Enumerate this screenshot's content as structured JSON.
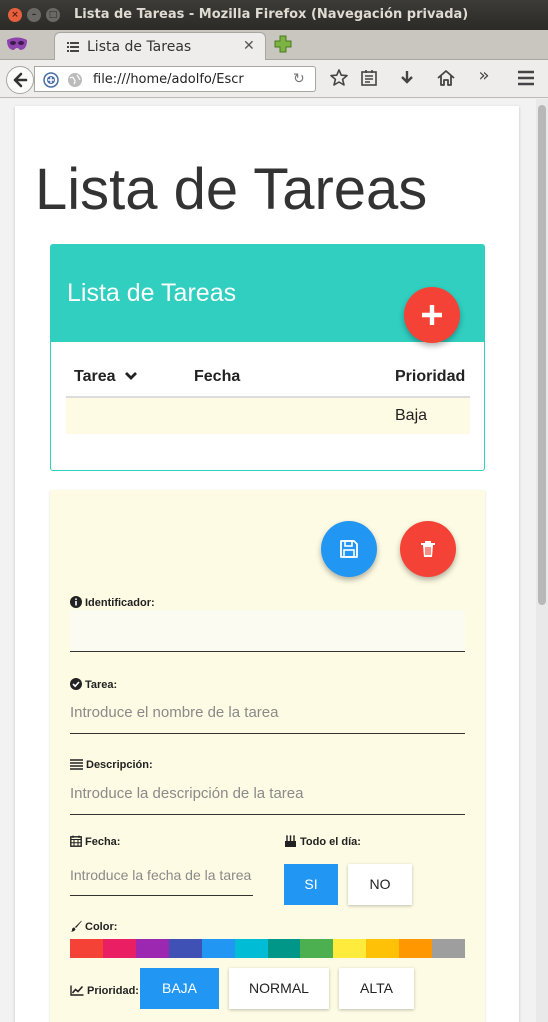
{
  "window": {
    "title": "Lista de Tareas - Mozilla Firefox (Navegación privada)",
    "close_glyph": "×",
    "min_glyph": "–",
    "max_glyph": "□"
  },
  "browser": {
    "tab_label": "Lista de Tareas",
    "tab_close_glyph": "✕",
    "url": "file:///home/adolfo/Escr",
    "reload_glyph": "↻",
    "toolbar_icons": [
      "star-icon",
      "reading-list-icon",
      "download-icon",
      "home-icon",
      "overflow-icon",
      "menu-icon"
    ],
    "overflow_glyph": "»"
  },
  "page": {
    "title": "Lista de Tareas",
    "panel_title": "Lista de Tareas",
    "table": {
      "columns": [
        "Tarea",
        "Fecha",
        "Prioridad"
      ],
      "rows": [
        {
          "tarea": "",
          "fecha": "",
          "prioridad": "Baja"
        }
      ]
    },
    "form": {
      "id_label": "Identificador:",
      "id_value": "",
      "task_label": "Tarea:",
      "task_placeholder": "Introduce el nombre de la tarea",
      "desc_label": "Descripción:",
      "desc_placeholder": "Introduce la descripción de la tarea",
      "date_label": "Fecha:",
      "date_placeholder": "Introduce la fecha de la tarea",
      "allday_label": "Todo el día:",
      "allday_options": [
        "SI",
        "NO"
      ],
      "allday_selected": "SI",
      "color_label": "Color:",
      "colors": [
        "#f44336",
        "#e91e63",
        "#9c27b0",
        "#3f51b5",
        "#2196f3",
        "#00bcd4",
        "#009688",
        "#4caf50",
        "#ffeb3b",
        "#ffc107",
        "#ff9800",
        "#9e9e9e"
      ],
      "priority_label": "Prioridad:",
      "priority_options": [
        "BAJA",
        "NORMAL",
        "ALTA"
      ],
      "priority_selected": "BAJA"
    }
  },
  "colors": {
    "teal": "#30cfc0",
    "red": "#f44336",
    "blue": "#2196f3",
    "form_bg": "#fdfbe3"
  }
}
